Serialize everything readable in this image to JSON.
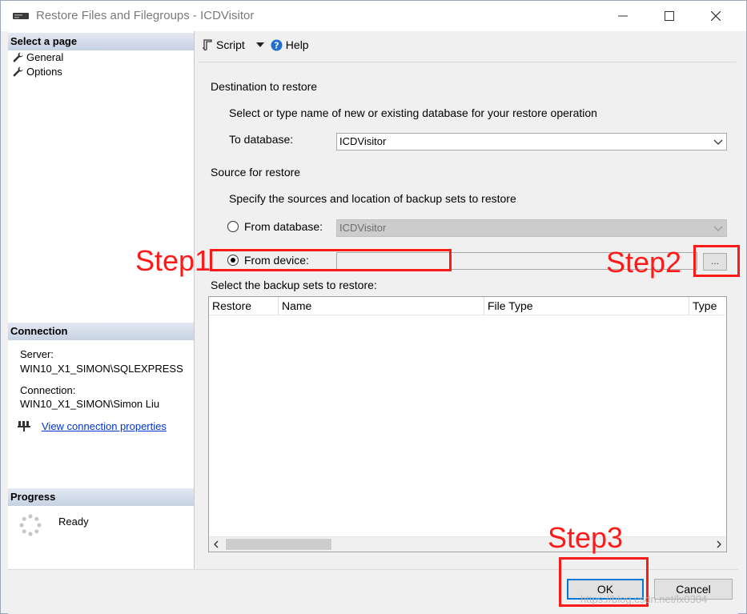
{
  "window": {
    "title": "Restore Files and Filegroups - ICDVisitor",
    "icon": "server-icon",
    "controls": [
      "minimize-icon",
      "maximize-icon",
      "close-icon"
    ]
  },
  "left_pane": {
    "select_page_header": "Select a page",
    "pages": [
      {
        "label": "General",
        "icon": "wrench-icon"
      },
      {
        "label": "Options",
        "icon": "wrench-icon"
      }
    ],
    "connection_header": "Connection",
    "server_label": "Server:",
    "server_value": "WIN10_X1_SIMON\\SQLEXPRESS",
    "connection_label": "Connection:",
    "connection_value": "WIN10_X1_SIMON\\Simon Liu",
    "view_connection_link": "View connection properties",
    "progress_header": "Progress",
    "progress_status": "Ready"
  },
  "toolbar": {
    "script_label": "Script",
    "help_label": "Help"
  },
  "destination": {
    "section_label": "Destination to restore",
    "instruction": "Select or type name of new or existing database for your restore operation",
    "to_database_label": "To database:",
    "to_database_value": "ICDVisitor"
  },
  "source": {
    "section_label": "Source for restore",
    "instruction": "Specify the sources and location of backup sets to restore",
    "from_database_label": "From database:",
    "from_database_value": "ICDVisitor",
    "from_device_label": "From device:",
    "from_device_value": "",
    "browse_label": "...",
    "selected": "from_device"
  },
  "backup_sets": {
    "label": "Select the backup sets to restore:",
    "columns": [
      "Restore",
      "Name",
      "File Type",
      "Type"
    ],
    "rows": []
  },
  "buttons": {
    "ok": "OK",
    "cancel": "Cancel"
  },
  "annotations": {
    "step1": "Step1",
    "step2": "Step2",
    "step3": "Step3",
    "color": "#ff1a1a"
  },
  "watermark": "https://blog.csdn.net/lx0304"
}
